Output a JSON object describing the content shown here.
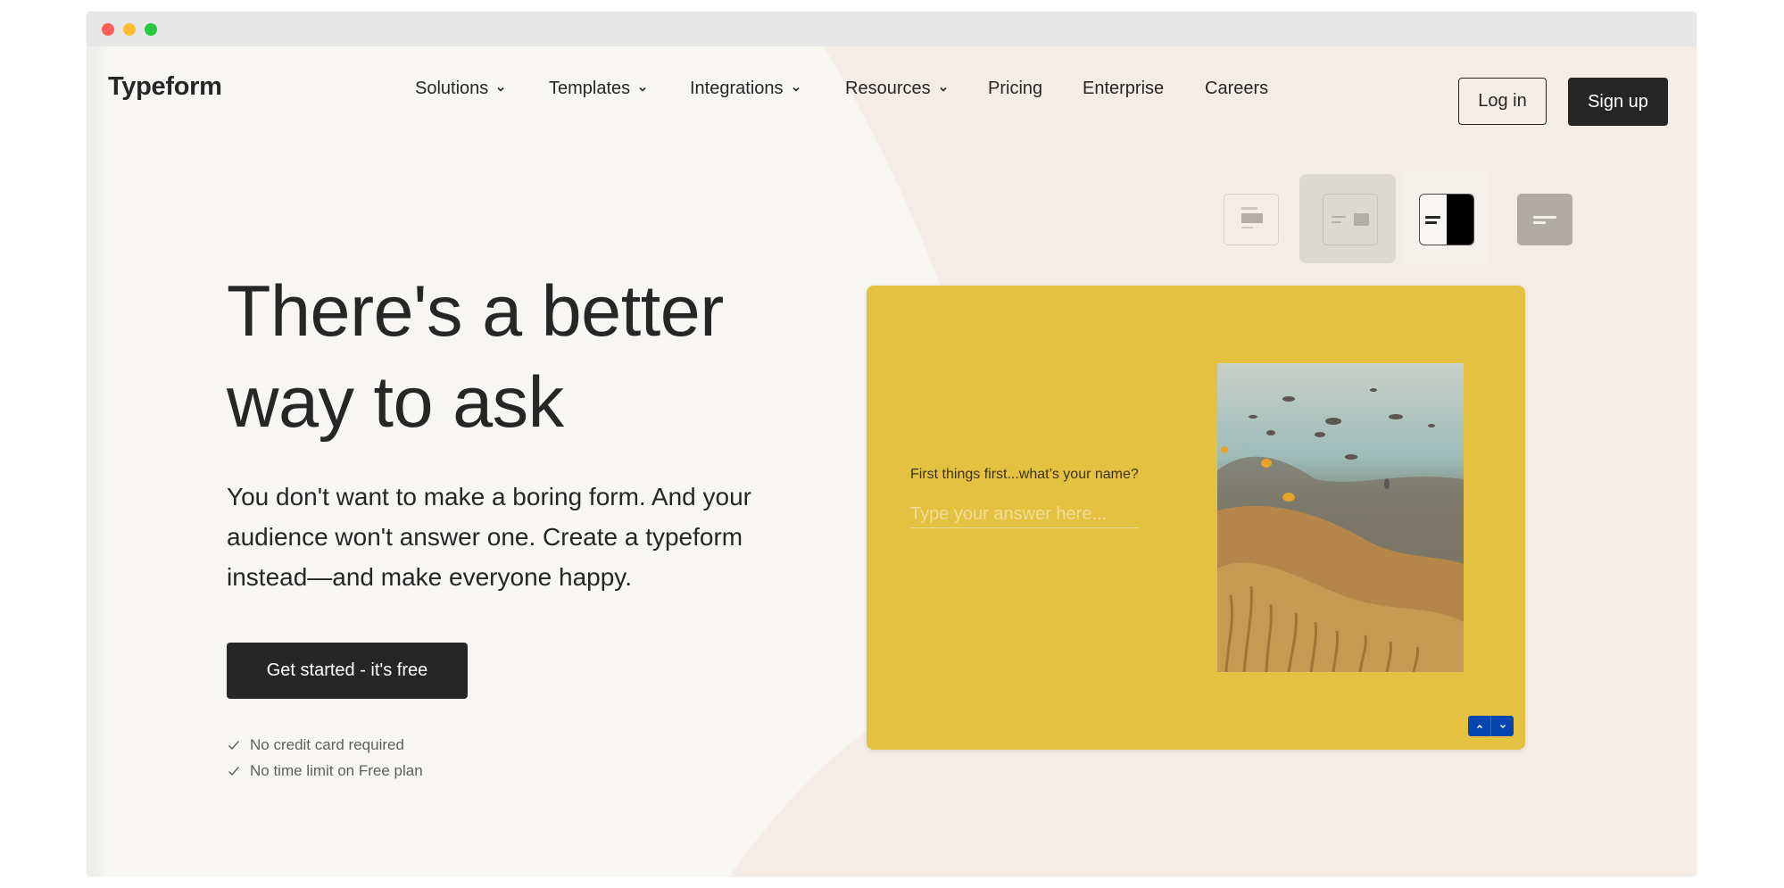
{
  "window": {
    "controls": [
      "close",
      "minimize",
      "maximize"
    ]
  },
  "header": {
    "logo": "Typeform",
    "nav": [
      {
        "label": "Solutions",
        "has_dropdown": true
      },
      {
        "label": "Templates",
        "has_dropdown": true
      },
      {
        "label": "Integrations",
        "has_dropdown": true
      },
      {
        "label": "Resources",
        "has_dropdown": true
      },
      {
        "label": "Pricing",
        "has_dropdown": false
      },
      {
        "label": "Enterprise",
        "has_dropdown": false
      },
      {
        "label": "Careers",
        "has_dropdown": false
      }
    ],
    "login_label": "Log in",
    "signup_label": "Sign up"
  },
  "hero": {
    "title_line1": "There's a better",
    "title_line2": "way to ask",
    "subtitle": "You don't want to make a boring form. And your audience won't answer one. Create a typeform instead—and make everyone happy.",
    "cta_label": "Get started - it's free",
    "checks": [
      {
        "icon": "check-icon",
        "label": "No credit card required"
      },
      {
        "icon": "check-icon",
        "label": "No time limit on Free plan"
      }
    ]
  },
  "layout_switcher": {
    "options": [
      {
        "name": "stack-layout",
        "selected": false
      },
      {
        "name": "split-image-right-layout",
        "selected": true
      },
      {
        "name": "split-dark-panel-layout",
        "selected": false
      },
      {
        "name": "wallpaper-layout",
        "selected": false
      }
    ]
  },
  "form_preview": {
    "question": "First things first...what’s your name?",
    "answer_placeholder": "Type your answer here...",
    "answer_value": "",
    "image_alt": "Coral reef with fish",
    "prev_icon": "chevron-up-icon",
    "next_icon": "chevron-down-icon",
    "colors": {
      "card_bg": "#e5c142",
      "nav_button": "#0445af"
    }
  },
  "colors": {
    "page_bg": "#f7f6f3",
    "accent_shape": "#f4ede7",
    "primary_dark": "#262627"
  }
}
